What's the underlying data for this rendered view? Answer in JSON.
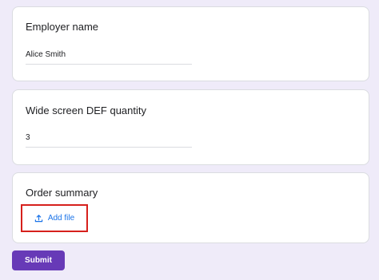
{
  "form": {
    "fields": [
      {
        "question": "Employer name",
        "answer": "Alice Smith"
      },
      {
        "question": "Wide screen DEF quantity",
        "answer": "3"
      },
      {
        "question": "Order summary",
        "button_label": "Add file",
        "button_icon": "upload-icon"
      }
    ],
    "submit_label": "Submit"
  },
  "colors": {
    "background": "#efebf9",
    "card": "#ffffff",
    "accent": "#673ab7",
    "link": "#1a73e8",
    "highlight_border": "#d6201c"
  }
}
